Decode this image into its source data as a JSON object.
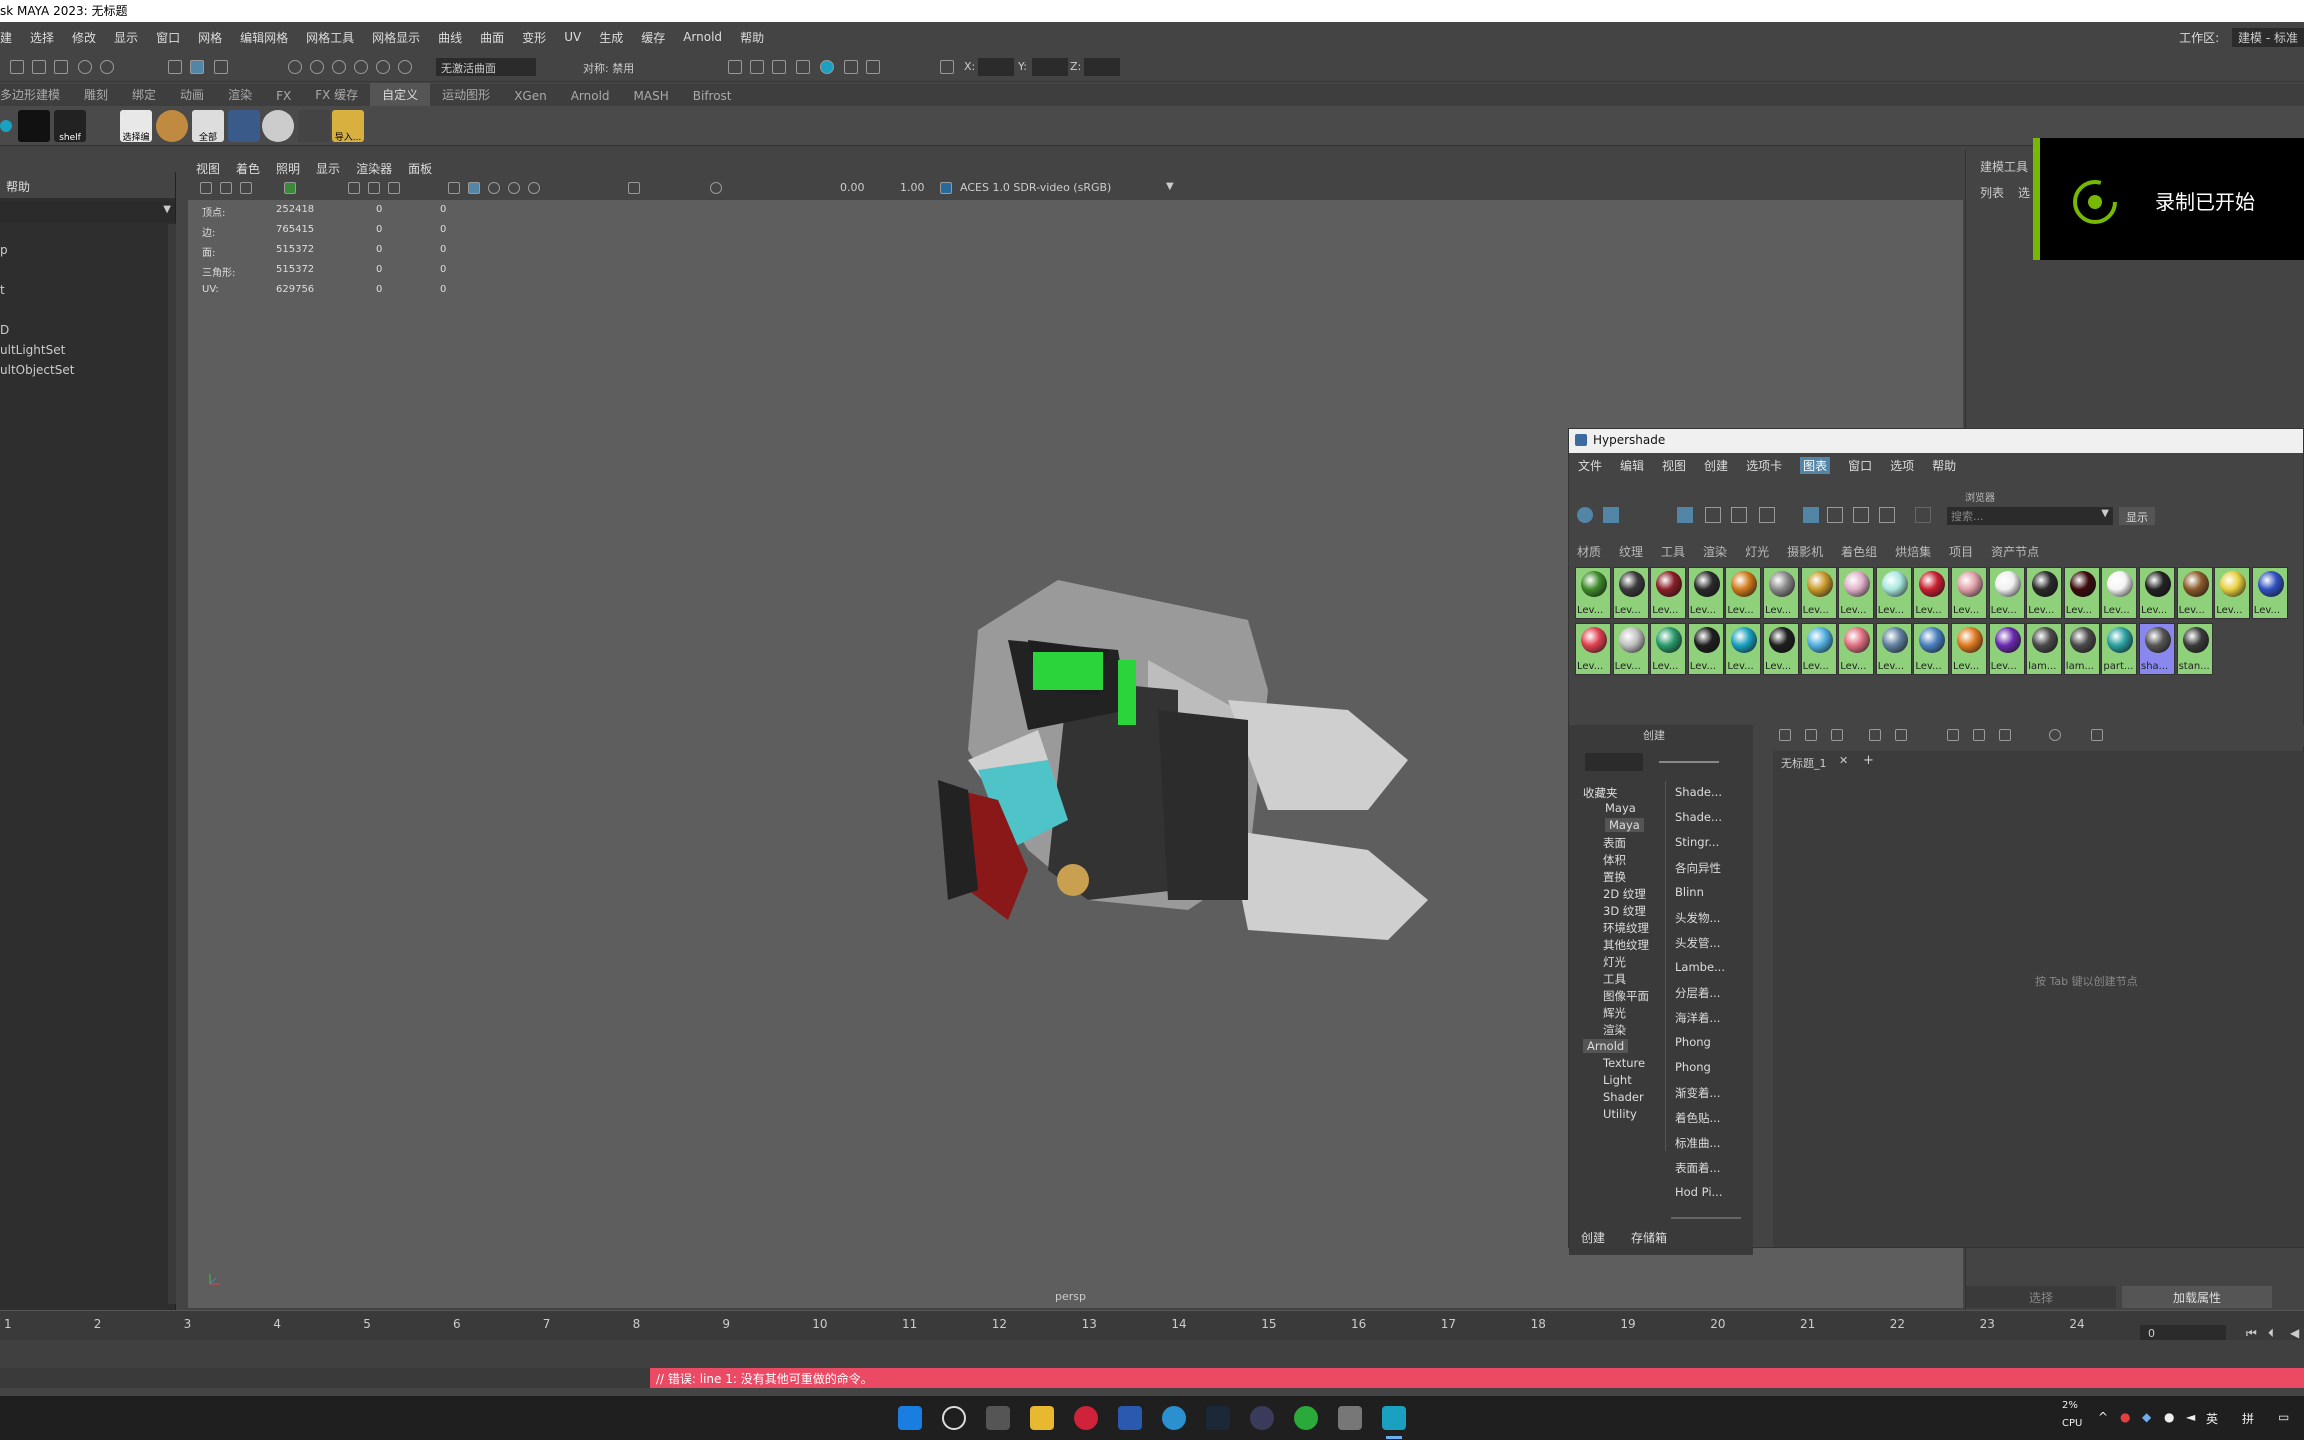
{
  "window_title": "sk MAYA 2023: 无标题",
  "menubar": {
    "items": [
      "建",
      "选择",
      "修改",
      "显示",
      "窗口",
      "网格",
      "编辑网格",
      "网格工具",
      "网格显示",
      "曲线",
      "曲面",
      "变形",
      "UV",
      "生成",
      "缓存",
      "Arnold",
      "帮助"
    ],
    "workspace_label": "工作区:",
    "workspace_value": "建模 - 标准"
  },
  "statusline": {
    "live_surface": "无激活曲面",
    "symmetry": "对称: 禁用",
    "x_label": "X:",
    "y_label": "Y:",
    "z_label": "Z:"
  },
  "shelf_tabs": [
    "多边形建模",
    "雕刻",
    "绑定",
    "动画",
    "渲染",
    "FX",
    "FX 缓存",
    "自定义",
    "运动图形",
    "XGen",
    "Arnold",
    "MASH",
    "Bifrost"
  ],
  "shelf_active": "自定义",
  "shelf_icons": [
    {
      "label": "shelf",
      "icon": "shelf-icon"
    },
    {
      "label": "选择编",
      "icon": "select-edit-icon"
    },
    {
      "label": "全部",
      "icon": "all-icon"
    },
    {
      "label": "导入...",
      "icon": "import-icon"
    }
  ],
  "outliner": {
    "header": "帮助",
    "rows": [
      "p",
      "t",
      "D",
      "ultLightSet",
      "ultObjectSet"
    ]
  },
  "viewport_menu": [
    "视图",
    "着色",
    "照明",
    "显示",
    "渲染器",
    "面板"
  ],
  "viewport_tool": {
    "val1": "0.00",
    "val2": "1.00",
    "colorspace": "ACES 1.0 SDR-video (sRGB)"
  },
  "hud_rows": [
    {
      "label": "顶点:",
      "a": "252418",
      "b": "0",
      "c": "0"
    },
    {
      "label": "边:",
      "a": "765415",
      "b": "0",
      "c": "0"
    },
    {
      "label": "面:",
      "a": "515372",
      "b": "0",
      "c": "0"
    },
    {
      "label": "三角形:",
      "a": "515372",
      "b": "0",
      "c": "0"
    },
    {
      "label": "UV:",
      "a": "629756",
      "b": "0",
      "c": "0"
    }
  ],
  "camera_label": "persp",
  "right_panel": {
    "title": "建模工具",
    "tab1": "列表",
    "tab2": "选",
    "select_btn": "选择",
    "attr_btn": "加载属性"
  },
  "recording": {
    "text": "录制已开始"
  },
  "hypershade": {
    "title": "Hypershade",
    "menus": [
      "文件",
      "编辑",
      "视图",
      "创建",
      "选项卡",
      "图表",
      "窗口",
      "选项",
      "帮助"
    ],
    "highlight_menu": "图表",
    "browser_label": "浏览器",
    "search_placeholder": "搜索...",
    "show_btn": "显示",
    "tabs": [
      "材质",
      "纹理",
      "工具",
      "渲染",
      "灯光",
      "摄影机",
      "着色组",
      "烘焙集",
      "项目",
      "资产节点"
    ],
    "create_label": "创建",
    "tree": [
      "收藏夹",
      "Maya",
      "Maya",
      "表面",
      "体积",
      "置换",
      "2D 纹理",
      "3D 纹理",
      "环境纹理",
      "其他纹理",
      "灯光",
      "工具",
      "图像平面",
      "辉光",
      "渲染",
      "Arnold",
      "Texture",
      "Light",
      "Shader",
      "Utility"
    ],
    "nodes": [
      "Shade...",
      "Shade...",
      "Stingr...",
      "各向异性",
      "Blinn",
      "头发物...",
      "头发管...",
      "Lambe...",
      "分层着...",
      "海洋着...",
      "Phong",
      "Phong",
      "渐变着...",
      "着色贴...",
      "标准曲...",
      "表面着...",
      "Hod Pi..."
    ],
    "graph_tab": "无标题_1",
    "hint": "按 Tab 键以创建节点",
    "bottom_tabs": [
      "创建",
      "存储箱"
    ]
  },
  "swatches_row1": [
    {
      "label": "Lev...",
      "color": "#3d8a2a"
    },
    {
      "label": "Lev...",
      "color": "#3a3a3a"
    },
    {
      "label": "Lev...",
      "color": "#8a1e28"
    },
    {
      "label": "Lev...",
      "color": "#2a2a2a"
    },
    {
      "label": "Lev...",
      "color": "#d07a1a"
    },
    {
      "label": "Lev...",
      "color": "#8a8a8a"
    },
    {
      "label": "Lev...",
      "color": "#c89a2a"
    },
    {
      "label": "Lev...",
      "color": "#e0b0c8"
    },
    {
      "label": "Lev...",
      "color": "#a8e8e0"
    },
    {
      "label": "Lev...",
      "color": "#c81e30"
    },
    {
      "label": "Lev...",
      "color": "#e0a0a8"
    },
    {
      "label": "Lev...",
      "color": "#f0f0f0"
    },
    {
      "label": "Lev...",
      "color": "#2a2a2a"
    },
    {
      "label": "Lev...",
      "color": "#3a0a0a"
    },
    {
      "label": "Lev...",
      "color": "#f4f4f4"
    },
    {
      "label": "Lev...",
      "color": "#222222"
    },
    {
      "label": "Lev...",
      "color": "#8a5a2a"
    },
    {
      "label": "Lev...",
      "color": "#e8d040"
    },
    {
      "label": "Lev...",
      "color": "#3050c0"
    }
  ],
  "swatches_row2": [
    {
      "label": "Lev...",
      "color": "#e04050"
    },
    {
      "label": "Lev...",
      "color": "#c0c0c0"
    },
    {
      "label": "Lev...",
      "color": "#2a9a6a"
    },
    {
      "label": "Lev...",
      "color": "#1e1e1e"
    },
    {
      "label": "Lev...",
      "color": "#1aa0c0"
    },
    {
      "label": "Lev...",
      "color": "#1e1e1e"
    },
    {
      "label": "Lev...",
      "color": "#50b0e0"
    },
    {
      "label": "Lev...",
      "color": "#e07080"
    },
    {
      "label": "Lev...",
      "color": "#6080a0"
    },
    {
      "label": "Lev...",
      "color": "#4a80c0"
    },
    {
      "label": "Lev...",
      "color": "#e07a20"
    },
    {
      "label": "Lev...",
      "color": "#6a2ab0"
    },
    {
      "label": "lam...",
      "color": "#4a4a4a"
    },
    {
      "label": "lam...",
      "color": "#4a4a4a"
    },
    {
      "label": "part...",
      "color": "#2aa0a0"
    },
    {
      "label": "sha...",
      "color": "#555555"
    },
    {
      "label": "stan...",
      "color": "#3a3a3a"
    }
  ],
  "timeline": {
    "frames": [
      "1",
      "2",
      "3",
      "4",
      "5",
      "6",
      "7",
      "8",
      "9",
      "10",
      "11",
      "12",
      "13",
      "14",
      "15",
      "16",
      "17",
      "18",
      "19",
      "20",
      "21",
      "22",
      "23",
      "24"
    ],
    "current": "0"
  },
  "error_line": "// 错误: line 1: 没有其他可重做的命令。",
  "taskbar": {
    "cpu_pct": "2%",
    "cpu_label": "CPU",
    "ime1": "英",
    "ime2": "拼"
  }
}
